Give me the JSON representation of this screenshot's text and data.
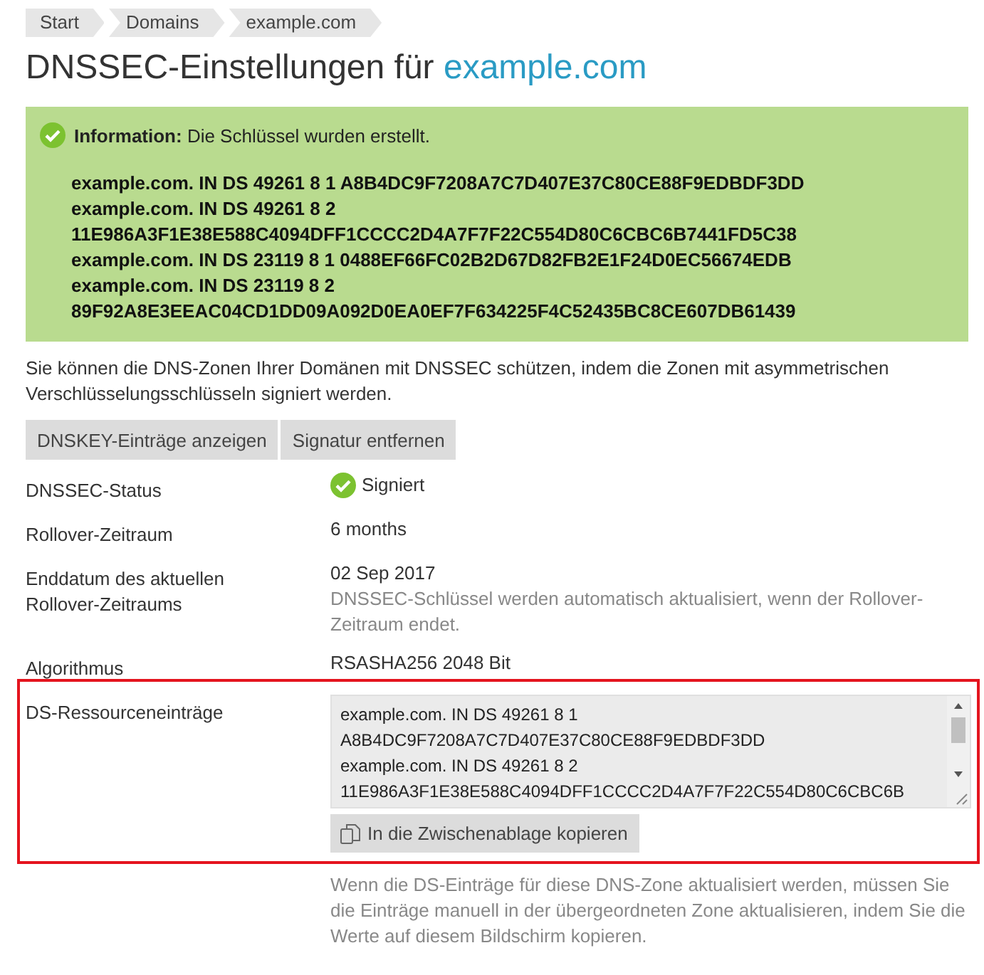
{
  "breadcrumb": [
    {
      "label": "Start"
    },
    {
      "label": "Domains"
    },
    {
      "label": "example.com"
    }
  ],
  "title": {
    "text": "DNSSEC-Einstellungen für",
    "domain": "example.com"
  },
  "info": {
    "label": "Information:",
    "message": "Die Schlüssel wurden erstellt.",
    "records": [
      "example.com. IN DS 49261 8 1 A8B4DC9F7208A7C7D407E37C80CE88F9EDBDF3DD",
      "example.com. IN DS 49261 8 2",
      "11E986A3F1E38E588C4094DFF1CCCC2D4A7F7F22C554D80C6CBC6B7441FD5C38",
      "example.com. IN DS 23119 8 1 0488EF66FC02B2D67D82FB2E1F24D0EC56674EDB",
      "example.com. IN DS 23119 8 2",
      "89F92A8E3EEAC04CD1DD09A092D0EA0EF7F634225F4C52435BC8CE607DB61439"
    ]
  },
  "description": "Sie können die DNS-Zonen Ihrer Domänen mit DNSSEC schützen, indem die Zonen mit asymmetrischen Verschlüsselungsschlüsseln signiert werden.",
  "buttons": [
    "DNSKEY-Einträge anzeigen",
    "Signatur entfernen"
  ],
  "details": [
    {
      "kind": "status",
      "label": "DNSSEC-Status",
      "value": "Signiert"
    },
    {
      "kind": "text",
      "label": "Rollover-Zeitraum",
      "value": "6 months"
    },
    {
      "kind": "text",
      "label": "Enddatum des aktuellen Rollover-Zeitraums",
      "value": "02 Sep 2017",
      "hint": "DNSSEC-Schlüssel werden automatisch aktualisiert, wenn der Rollover-Zeitraum endet."
    },
    {
      "kind": "text",
      "label": "Algorithmus",
      "value": "RSASHA256 2048 Bit"
    },
    {
      "kind": "records",
      "label": "DS-Ressourceneinträge",
      "lines": [
        "example.com. IN DS 49261 8 1",
        "A8B4DC9F7208A7C7D407E37C80CE88F9EDBDF3DD",
        "example.com. IN DS 49261 8 2",
        "11E986A3F1E38E588C4094DFF1CCCC2D4A7F7F22C554D80C6CBC6B"
      ],
      "copy_button": "In die Zwischenablage kopieren",
      "hint": "Wenn die DS-Einträge für diese DNS-Zone aktualisiert werden, müssen Sie die Einträge manuell in der übergeordneten Zone aktualisieren, indem Sie die Werte auf diesem Bildschirm kopieren."
    }
  ]
}
